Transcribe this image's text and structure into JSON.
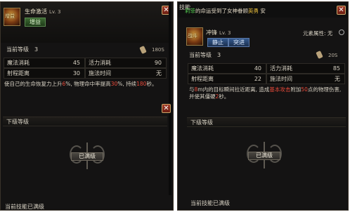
{
  "left": {
    "skill_name": "生命激活",
    "skill_level": "Lv. 3",
    "icon_tag": "增益",
    "tab_label": "增益",
    "current_level_label": "当前等级",
    "current_level_value": "3",
    "max_level": "180S",
    "stats": [
      {
        "label": "魔法消耗",
        "value": "45"
      },
      {
        "label": "活力消耗",
        "value": "90"
      },
      {
        "label": "射程距离",
        "value": "30"
      },
      {
        "label": "施法时间",
        "value": "无"
      }
    ],
    "desc_1": "使自己的生命恢复力上升",
    "desc_hl_1": "6",
    "desc_2": "%, 物理命中率提高",
    "desc_hl_2": "30",
    "desc_3": "%, 持续",
    "desc_hl_3": "180",
    "desc_4": "秒。",
    "next_level_label": "下级等级",
    "maxed_label": "已满级",
    "status": "当前技能已满级",
    "close_glyph": "✕"
  },
  "right": {
    "title_fragment": "技能",
    "marquee_green": "莉菲",
    "marquee_text": "的命运受到了女神眷顾",
    "marquee_yellow": "英勇",
    "marquee_tail": " 安",
    "skill_name": "冲锋",
    "skill_level": "Lv. 3",
    "icon_tag": "战斗",
    "element_label": "元素属性: 无",
    "tabs": [
      "静止",
      "突进"
    ],
    "current_level_label": "当前等级",
    "current_level_value": "3",
    "max_level": "20S",
    "stats": [
      {
        "label": "魔法消耗",
        "value": "40"
      },
      {
        "label": "活力消耗",
        "value": "85"
      },
      {
        "label": "射程距离",
        "value": "22"
      },
      {
        "label": "施法时间",
        "value": "无"
      }
    ],
    "desc_1": "与",
    "desc_hl_1": "8",
    "desc_2": "m内的目标瞬间拉近距离, 造成",
    "desc_hl_2": "基本攻击",
    "desc_3": "附加",
    "desc_hl_3": "50",
    "desc_4": "点的物",
    "desc_5": "理伤害, 并使其僵硬",
    "desc_hl_4": "2",
    "desc_6": "秒。",
    "next_level_label": "下级等级",
    "maxed_label": "已满级",
    "status": "当前技能已满级",
    "close_glyph": "✕"
  },
  "colors": {
    "highlight": "#e84a3a",
    "green_tab": "#3c6a32",
    "blue_tab": "#345a8e",
    "frame": "#141313"
  }
}
